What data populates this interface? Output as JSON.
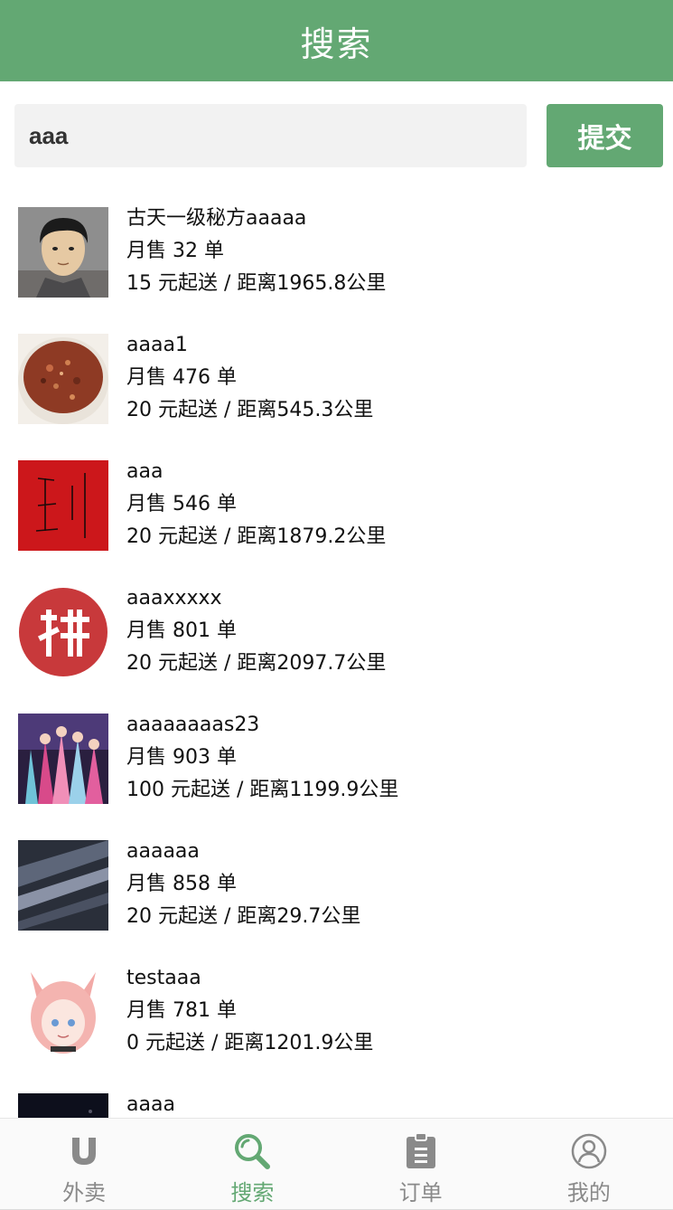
{
  "header": {
    "title": "搜索"
  },
  "search": {
    "value": "aaa",
    "submit_label": "提交"
  },
  "shops": [
    {
      "name": "古天一级秘方aaaaa",
      "sales": "月售 32 单",
      "delivery": "15 元起送 / 距离1965.8公里",
      "thumb": "portrait-man"
    },
    {
      "name": "aaaa1",
      "sales": "月售 476 单",
      "delivery": "20 元起送 / 距离545.3公里",
      "thumb": "porridge-bowl"
    },
    {
      "name": "aaa",
      "sales": "月售 546 单",
      "delivery": "20 元起送 / 距离1879.2公里",
      "thumb": "red-sketch"
    },
    {
      "name": "aaaxxxxx",
      "sales": "月售 801 单",
      "delivery": "20 元起送 / 距离2097.7公里",
      "thumb": "pin-logo"
    },
    {
      "name": "aaaaaaaas23",
      "sales": "月售 903 单",
      "delivery": "100 元起送 / 距离1199.9公里",
      "thumb": "anime-group"
    },
    {
      "name": "aaaaaa",
      "sales": "月售 858 单",
      "delivery": "20 元起送 / 距离29.7公里",
      "thumb": "dark-fabric"
    },
    {
      "name": "testaaa",
      "sales": "月售 781 单",
      "delivery": "0 元起送 / 距离1201.9公里",
      "thumb": "anime-foxgirl"
    },
    {
      "name": "aaaa",
      "sales": "",
      "delivery": "",
      "thumb": "night-sky"
    }
  ],
  "tabs": [
    {
      "label": "外卖",
      "icon": "u-logo-icon",
      "active": false
    },
    {
      "label": "搜索",
      "icon": "search-icon",
      "active": true
    },
    {
      "label": "订单",
      "icon": "clipboard-icon",
      "active": false
    },
    {
      "label": "我的",
      "icon": "user-icon",
      "active": false
    }
  ],
  "colors": {
    "accent": "#63a873",
    "inactive": "#8a8a8a",
    "input_bg": "#f2f2f2"
  }
}
